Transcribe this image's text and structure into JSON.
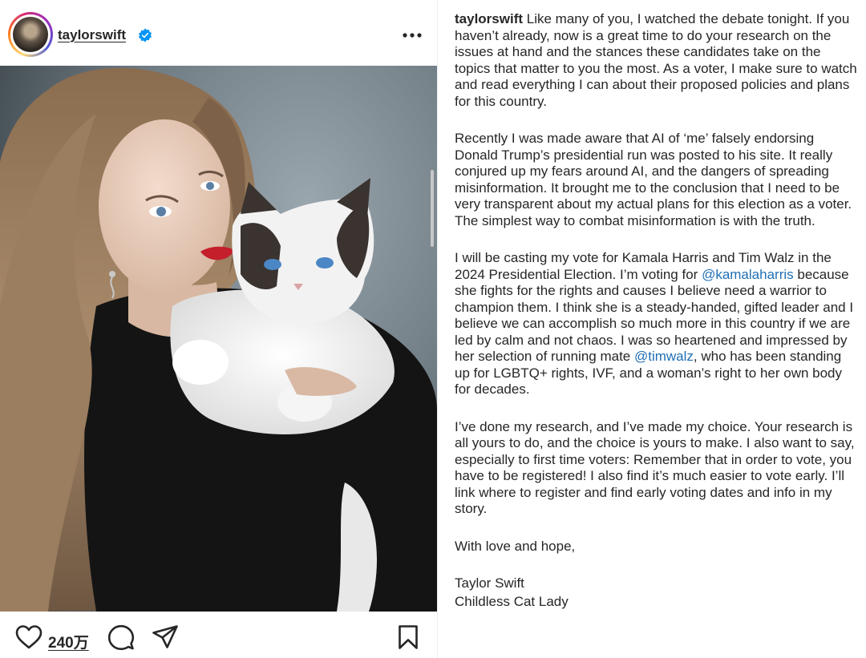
{
  "post": {
    "username": "taylorswift",
    "likes": "240万"
  },
  "icons": {
    "verified": "verified-badge-icon",
    "more": "more-options-icon",
    "like": "heart-icon",
    "comment": "comment-icon",
    "share": "share-icon",
    "save": "bookmark-icon"
  },
  "colors": {
    "text": "#262626",
    "link": "#1f6fb5",
    "verified": "#0095f6"
  },
  "caption": {
    "p1_after_handle": " Like many of you, I watched the debate tonight. If you haven’t already, now is a great time to do your research on the issues at hand and the stances these candidates take on the topics that matter to you the most. As a voter, I make sure to watch and read everything I can about their proposed policies and plans for this country.",
    "p2": "Recently I was made aware that AI of ‘me’ falsely endorsing Donald Trump’s presidential run was posted to his site. It really conjured up my fears around AI, and the dangers of spreading misinformation. It brought me to the conclusion that I need to be very transparent about my actual plans for this election as a voter. The simplest way to combat misinformation is with the truth.",
    "p3_a": "I will be casting my vote for Kamala Harris and Tim Walz in the 2024 Presidential Election. I’m voting for ",
    "p3_mention1": "@kamalaharris",
    "p3_b": " because she fights for the rights and causes I believe need a warrior to champion them. I think she is a steady-handed, gifted leader and I believe we can accomplish so much more in this country if we are led by calm and not chaos. I was so heartened and impressed by her selection of running mate ",
    "p3_mention2": "@timwalz",
    "p3_c": ", who has been standing up for LGBTQ+ rights, IVF, and a woman’s right to her own body for decades.",
    "p4": "I’ve done my research, and I’ve made my choice. Your research is all yours to do, and the choice is yours to make. I also want to say, especially to first time voters: Remember that in order to vote, you have to be registered! I also find it’s much easier to vote early. I’ll link where to register and find early voting dates and info in my story.",
    "p5": "With love and hope,",
    "sign1": "Taylor Swift",
    "sign2": "Childless Cat Lady"
  }
}
